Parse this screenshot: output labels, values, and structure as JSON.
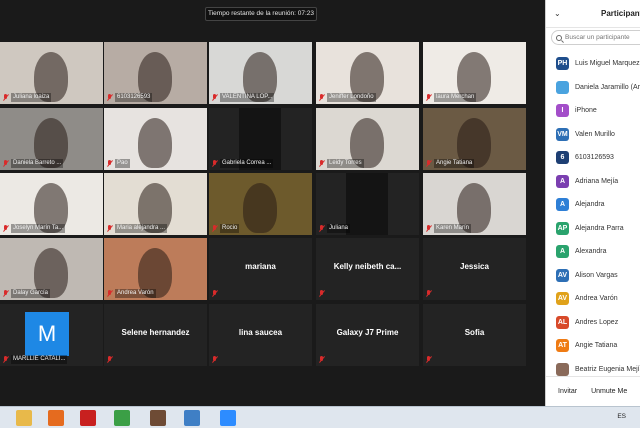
{
  "meeting": {
    "timer_text": "Tiempo restante de la reunión: 07:23",
    "tiles": [
      {
        "id": "t1",
        "name": "Juliana loaiza",
        "kind": "video",
        "bg": "#cfc8c0"
      },
      {
        "id": "t2",
        "name": "6103126593",
        "kind": "video",
        "bg": "#b7aca4"
      },
      {
        "id": "t3",
        "name": "VALENTINA LOP...",
        "kind": "video",
        "bg": "#d8d8d6"
      },
      {
        "id": "t4",
        "name": "Jeniffer Londoño",
        "kind": "video",
        "bg": "#e8e2dc"
      },
      {
        "id": "t5",
        "name": "laura Merchan",
        "kind": "video",
        "bg": "#efebe6"
      },
      {
        "id": "t6",
        "name": "Daniela Barreto ...",
        "kind": "video",
        "bg": "#8f8c88"
      },
      {
        "id": "t7",
        "name": "Pao",
        "kind": "video",
        "bg": "#e7e3e0"
      },
      {
        "id": "t8",
        "name": "Gabriela Correa ...",
        "kind": "dark",
        "bg": "#141414"
      },
      {
        "id": "t9",
        "name": "Leidy Torres",
        "kind": "video",
        "bg": "#dcd8d2"
      },
      {
        "id": "t10",
        "name": "Angie Tatiana",
        "kind": "video",
        "bg": "#6b5a44"
      },
      {
        "id": "t11",
        "name": "Joselyn Marín Ta...",
        "kind": "video",
        "bg": "#ece9e4"
      },
      {
        "id": "t12",
        "name": "Maria alejandra ...",
        "kind": "video",
        "bg": "#e3ddd3"
      },
      {
        "id": "t13",
        "name": "Rocio",
        "kind": "video",
        "bg": "#6d5a2c"
      },
      {
        "id": "t14",
        "name": "Juliana",
        "kind": "dark",
        "bg": "#141414"
      },
      {
        "id": "t15",
        "name": "Karen Marín",
        "kind": "video",
        "bg": "#d9d6d2"
      },
      {
        "id": "t16",
        "name": "Dalay García",
        "kind": "video",
        "bg": "#bfb9b3"
      },
      {
        "id": "t17",
        "name": "Andrea Varón",
        "kind": "video",
        "bg": "#bd7c5a"
      },
      {
        "id": "t18",
        "name": "mariana",
        "kind": "nameonly"
      },
      {
        "id": "t19",
        "name": "Kelly  neibeth ca...",
        "kind": "nameonly"
      },
      {
        "id": "t20",
        "name": "Jessica",
        "kind": "nameonly"
      },
      {
        "id": "t21",
        "name": "MARLLIE CATALI...",
        "kind": "avatar",
        "avatar_letter": "M",
        "avatar_color": "#1e88e5"
      },
      {
        "id": "t22",
        "name": "Selene hernandez",
        "kind": "nameonly"
      },
      {
        "id": "t23",
        "name": "lina saucea",
        "kind": "nameonly"
      },
      {
        "id": "t24",
        "name": "Galaxy J7 Prime",
        "kind": "nameonly"
      },
      {
        "id": "t25",
        "name": "Sofia",
        "kind": "nameonly"
      }
    ]
  },
  "panel": {
    "collapse_icon": "chevron-down-icon",
    "title": "Participante",
    "search_placeholder": "Buscar un participante",
    "participants": [
      {
        "avatar": "PH",
        "color": "#1f4e8c",
        "name": "Luis Miguel Marquez"
      },
      {
        "avatar": "",
        "color": "#4aa3df",
        "name": "Daniela Jaramillo (Ar"
      },
      {
        "avatar": "I",
        "color": "#a34ec9",
        "name": "iPhone"
      },
      {
        "avatar": "VM",
        "color": "#2d6fb5",
        "name": "Valen Murillo"
      },
      {
        "avatar": "6",
        "color": "#1e3f73",
        "name": "6103126593"
      },
      {
        "avatar": "A",
        "color": "#7b3fb0",
        "name": "Adriana Mejía"
      },
      {
        "avatar": "A",
        "color": "#2e7fd6",
        "name": "Alejandra"
      },
      {
        "avatar": "AP",
        "color": "#2aa36d",
        "name": "Alejandra Parra"
      },
      {
        "avatar": "A",
        "color": "#2aa36d",
        "name": "Alexandra"
      },
      {
        "avatar": "AV",
        "color": "#2d6fb5",
        "name": "Alison Vargas"
      },
      {
        "avatar": "AV",
        "color": "#e0a21b",
        "name": "Andrea Varón"
      },
      {
        "avatar": "AL",
        "color": "#d84a2a",
        "name": "Andres Lopez"
      },
      {
        "avatar": "AT",
        "color": "#ef7b14",
        "name": "Angie Tatiana"
      },
      {
        "avatar": "",
        "color": "#8a6a5a",
        "name": "Beatriz Eugenia Mejía"
      }
    ],
    "invite_label": "Invitar",
    "unmute_label": "Unmute Me"
  },
  "taskbar": {
    "language": "ES",
    "apps": [
      {
        "icon": "file-explorer-icon",
        "color": "#e8b94a"
      },
      {
        "icon": "media-player-icon",
        "color": "#e56b1f"
      },
      {
        "icon": "acrobat-reader-icon",
        "color": "#c8201f"
      },
      {
        "icon": "chrome-icon",
        "color": "#3b9f46"
      },
      {
        "icon": "photo-app-icon",
        "color": "#6e4b35"
      },
      {
        "icon": "paint-icon",
        "color": "#3f7fc5"
      },
      {
        "icon": "zoom-icon",
        "color": "#2d8cff"
      }
    ]
  }
}
